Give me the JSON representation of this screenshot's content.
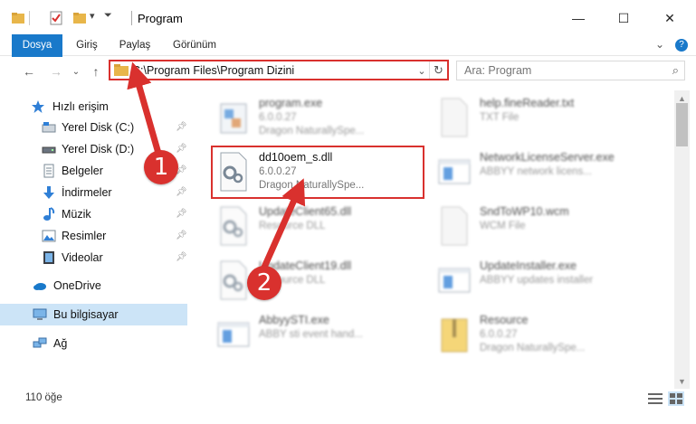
{
  "window": {
    "title": "Program",
    "minimize": "—",
    "maximize": "☐",
    "close": "✕"
  },
  "ribbon": {
    "tabs": [
      "Dosya",
      "Giriş",
      "Paylaş",
      "Görünüm"
    ],
    "expand": "⌄",
    "help": "?"
  },
  "nav": {
    "back": "←",
    "forward": "→",
    "recent": "⌄",
    "up": "↑"
  },
  "address": {
    "path": "C:\\Program Files\\Program Dizini",
    "dropdown": "⌄",
    "refresh": "↻"
  },
  "search": {
    "placeholder": "Ara: Program",
    "icon": "⌕"
  },
  "sidebar": {
    "quick_access": "Hızlı erişim",
    "items": [
      {
        "label": "Yerel Disk (C:)",
        "pinned": true
      },
      {
        "label": "Yerel Disk (D:)",
        "pinned": true
      },
      {
        "label": "Belgeler",
        "pinned": true
      },
      {
        "label": "İndirmeler",
        "pinned": true
      },
      {
        "label": "Müzik",
        "pinned": true
      },
      {
        "label": "Resimler",
        "pinned": true
      },
      {
        "label": "Videolar",
        "pinned": true
      }
    ],
    "onedrive": "OneDrive",
    "this_pc": "Bu bilgisayar",
    "network": "Ağ"
  },
  "files": [
    {
      "name": "program.exe",
      "meta1": "6.0.0.27",
      "meta2": "Dragon NaturallySpe...",
      "icon": "exe-icon"
    },
    {
      "name": "help.fineReader.txt",
      "meta1": "TXT File",
      "meta2": "",
      "icon": "txt-icon"
    },
    {
      "name": "dd10oem_s.dll",
      "meta1": "6.0.0.27",
      "meta2": "Dragon NaturallySpe...",
      "icon": "dll-icon"
    },
    {
      "name": "NetworkLicenseServer.exe",
      "meta1": "ABBYY network licens...",
      "meta2": "",
      "icon": "window-icon"
    },
    {
      "name": "UpdateClient65.dll",
      "meta1": "Resource DLL",
      "meta2": "",
      "icon": "dll-icon"
    },
    {
      "name": "SndToWP10.wcm",
      "meta1": "WCM File",
      "meta2": "",
      "icon": "file-icon"
    },
    {
      "name": "UpdateClient19.dll",
      "meta1": "Resource DLL",
      "meta2": "",
      "icon": "dll-icon"
    },
    {
      "name": "UpdateInstaller.exe",
      "meta1": "ABBYY updates installer",
      "meta2": "",
      "icon": "window-icon"
    },
    {
      "name": "AbbyySTI.exe",
      "meta1": "ABBY sti event hand...",
      "meta2": "",
      "icon": "window-icon"
    },
    {
      "name": "Resource",
      "meta1": "6.0.0.27",
      "meta2": "Dragon NaturallySpe...",
      "icon": "zip-icon"
    }
  ],
  "status": {
    "count": "110 öğe"
  },
  "annotations": {
    "step1": "1",
    "step2": "2"
  },
  "colors": {
    "accent": "#1979ca",
    "highlight": "#d9312e",
    "selected": "#cce4f7"
  }
}
